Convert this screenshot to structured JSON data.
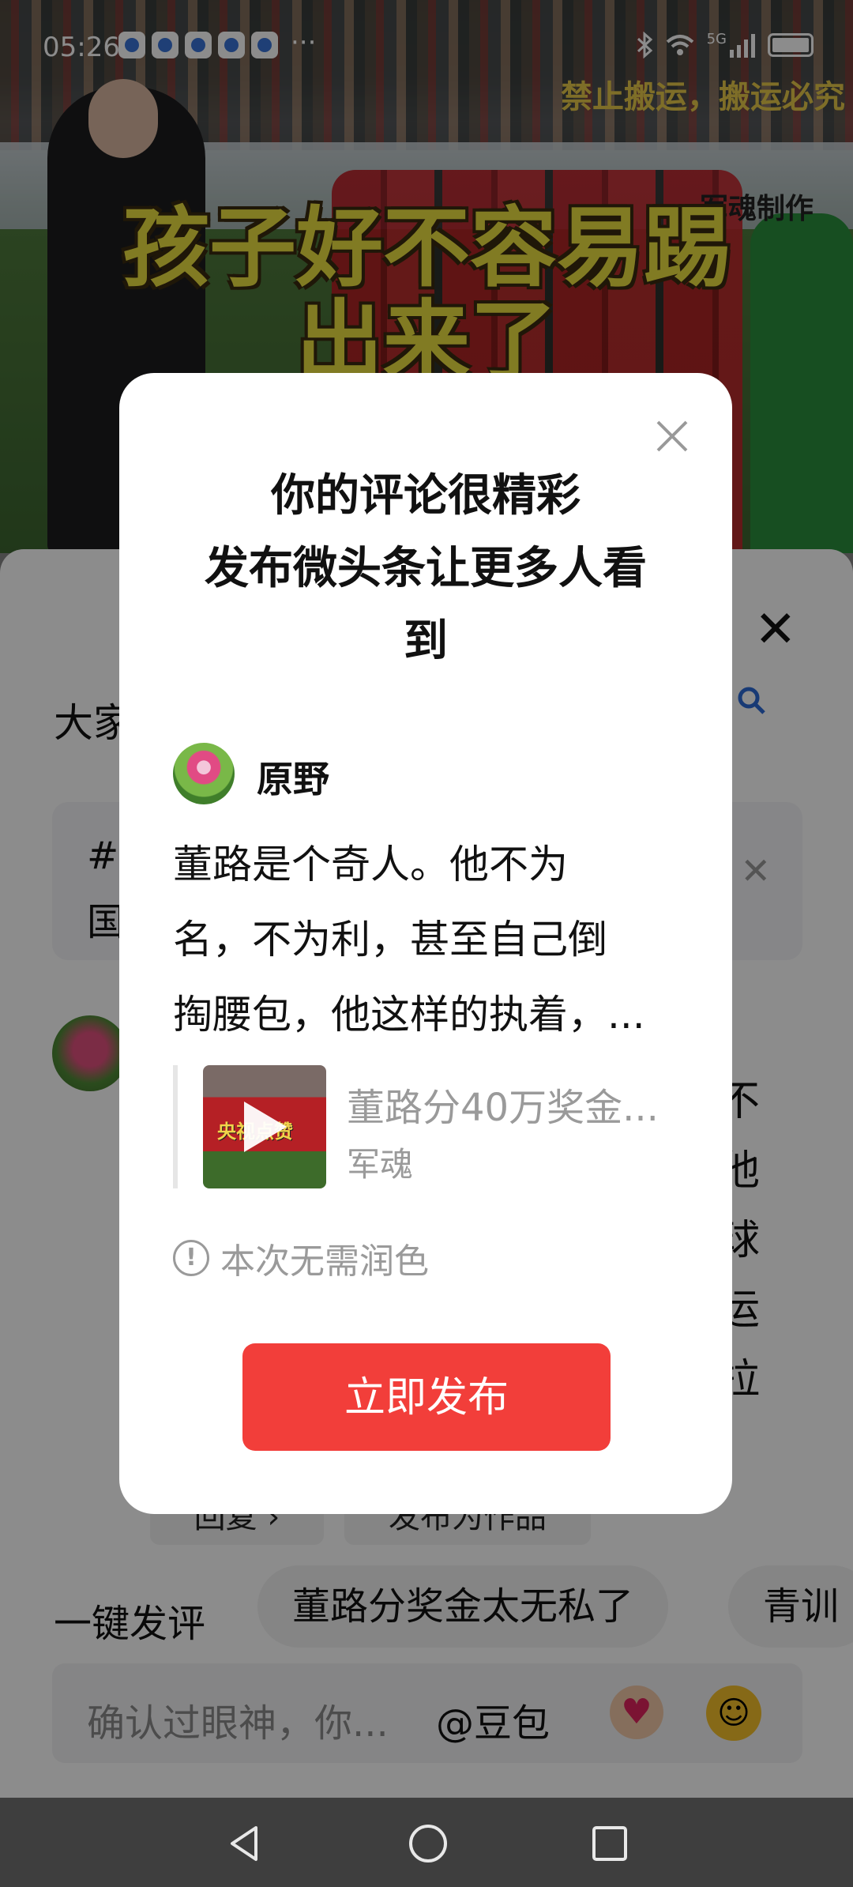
{
  "status_bar": {
    "time": "05:26",
    "more": "···",
    "network": "5G"
  },
  "video": {
    "watermark": "禁止搬运，搬运必究",
    "brand": "军魂制作",
    "caption_line1": "孩子好不容易踢",
    "caption_line2": "出来了"
  },
  "comment_sheet": {
    "header_text": "大家",
    "topic_line1": "#",
    "topic_line2": "国",
    "side_chars": [
      "不",
      "他",
      "球",
      "运",
      "拉"
    ],
    "reply_label": "回复 ›",
    "publish_as_work_label": "发布为作品",
    "quick_comment_label": "一键发评",
    "chips": [
      "董路分奖金太无私了",
      "青训"
    ],
    "input_placeholder": "确认过眼神，你...",
    "input_mention": "@豆包"
  },
  "modal": {
    "title_lines": [
      "你的评论很精彩",
      "发布微头条让更多人看",
      "到"
    ],
    "username": "原野",
    "body_lines": [
      "董路是个奇人。他不为",
      "名，不为利，甚至自己倒",
      "掏腰包，他这样的执着，..."
    ],
    "quote_thumb_label": "央视点赞",
    "quote_title": "董路分40万奖金...",
    "quote_author": "军魂",
    "info_text": "本次无需润色",
    "publish_button": "立即发布"
  },
  "colors": {
    "accent_red": "#f23e3a",
    "link_blue": "#2d6bd6",
    "muted_gray": "#9a9a9a"
  },
  "icons": {
    "modal_close": "close-icon",
    "sheet_close": "close-icon",
    "search": "search-icon",
    "info": "info-circle-icon",
    "play": "play-icon",
    "nav_back": "triangle-back-icon",
    "nav_home": "circle-home-icon",
    "nav_recent": "square-recent-icon"
  }
}
